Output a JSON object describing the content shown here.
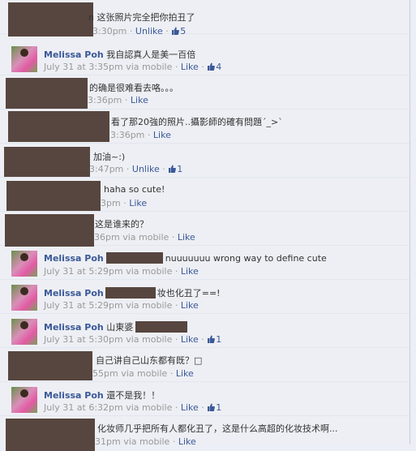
{
  "comments": [
    {
      "author": "",
      "text": "n 这张照片完全把你拍丑了",
      "time": "3:30pm",
      "via": "",
      "action": "Unlike",
      "likes": "5"
    },
    {
      "author": "Melissa Poh",
      "text": "我自認真人是美一百倍",
      "time": "July 31 at 3:35pm",
      "via": "via mobile",
      "action": "Like",
      "likes": "4"
    },
    {
      "author": "",
      "text": "的确是很难看去咯。。。",
      "time": "3:36pm",
      "via": "",
      "action": "Like",
      "likes": ""
    },
    {
      "author": "",
      "text": "看了那20強的照片..攝影師的確有問題´_>`",
      "time": "3:36pm",
      "via": "",
      "action": "Like",
      "likes": ""
    },
    {
      "author": "",
      "text": "加油~:)",
      "time": "3:47pm",
      "via": "",
      "action": "Unlike",
      "likes": "1"
    },
    {
      "author": "",
      "text": "haha so cute!",
      "time": "3pm",
      "via": "",
      "action": "Like",
      "likes": ""
    },
    {
      "author": "",
      "text": "这是谁来的？",
      "time": "36pm",
      "via": "via mobile",
      "action": "Like",
      "likes": ""
    },
    {
      "author": "Melissa Poh",
      "text": "nuuuuuuu wrong way to define cute",
      "time": "July 31 at 5:29pm",
      "via": "via mobile",
      "action": "Like",
      "likes": ""
    },
    {
      "author": "Melissa Poh",
      "text": "妆也化丑了==!",
      "time": "July 31 at 5:29pm",
      "via": "via mobile",
      "action": "Like",
      "likes": ""
    },
    {
      "author": "Melissa Poh",
      "text": "山東婆",
      "time": "July 31 at 5:30pm",
      "via": "via mobile",
      "action": "Like",
      "likes": "1"
    },
    {
      "author": "",
      "text": "自己讲自己山东都有既？□",
      "time": "55pm",
      "via": "via mobile",
      "action": "Like",
      "likes": ""
    },
    {
      "author": "Melissa Poh",
      "text": "還不是我！！",
      "time": "July 31 at 6:32pm",
      "via": "via mobile",
      "action": "Like",
      "likes": "1"
    },
    {
      "author": "",
      "text": "化妆师几乎把所有人都化丑了，这是什么高超的化妆技术啊...",
      "time": "31pm",
      "via": "via mobile",
      "action": "Like",
      "likes": ""
    }
  ],
  "colors": {
    "link": "#3b5998",
    "meta": "#999999",
    "redaction": "#56463f",
    "background": "#edeff4"
  },
  "icons": {
    "like": "thumbs-up-icon"
  }
}
